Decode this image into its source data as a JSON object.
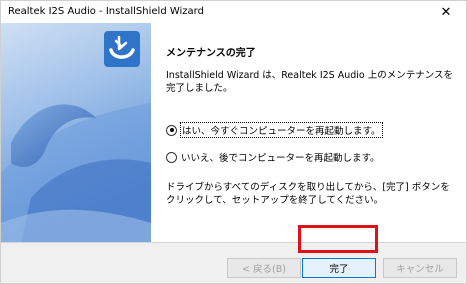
{
  "window": {
    "title": "Realtek I2S Audio - InstallShield Wizard",
    "close_glyph": "✕"
  },
  "content": {
    "heading": "メンテナンスの完了",
    "message": "InstallShield Wizard は、Realtek I2S Audio 上のメンテナンスを完了しました。",
    "options": [
      {
        "label": "はい、今すぐコンピューターを再起動します。",
        "selected": true
      },
      {
        "label": "いいえ、後でコンピューターを再起動します。",
        "selected": false
      }
    ],
    "note": "ドライブからすべてのディスクを取り出してから、[完了] ボタンをクリックして、セットアップを終了してください。"
  },
  "buttons": {
    "back": "< 戻る(B)",
    "finish": "完了",
    "cancel": "キャンセル"
  },
  "colors": {
    "banner_blue": "#2f74c8",
    "highlight": "#e0101a"
  }
}
